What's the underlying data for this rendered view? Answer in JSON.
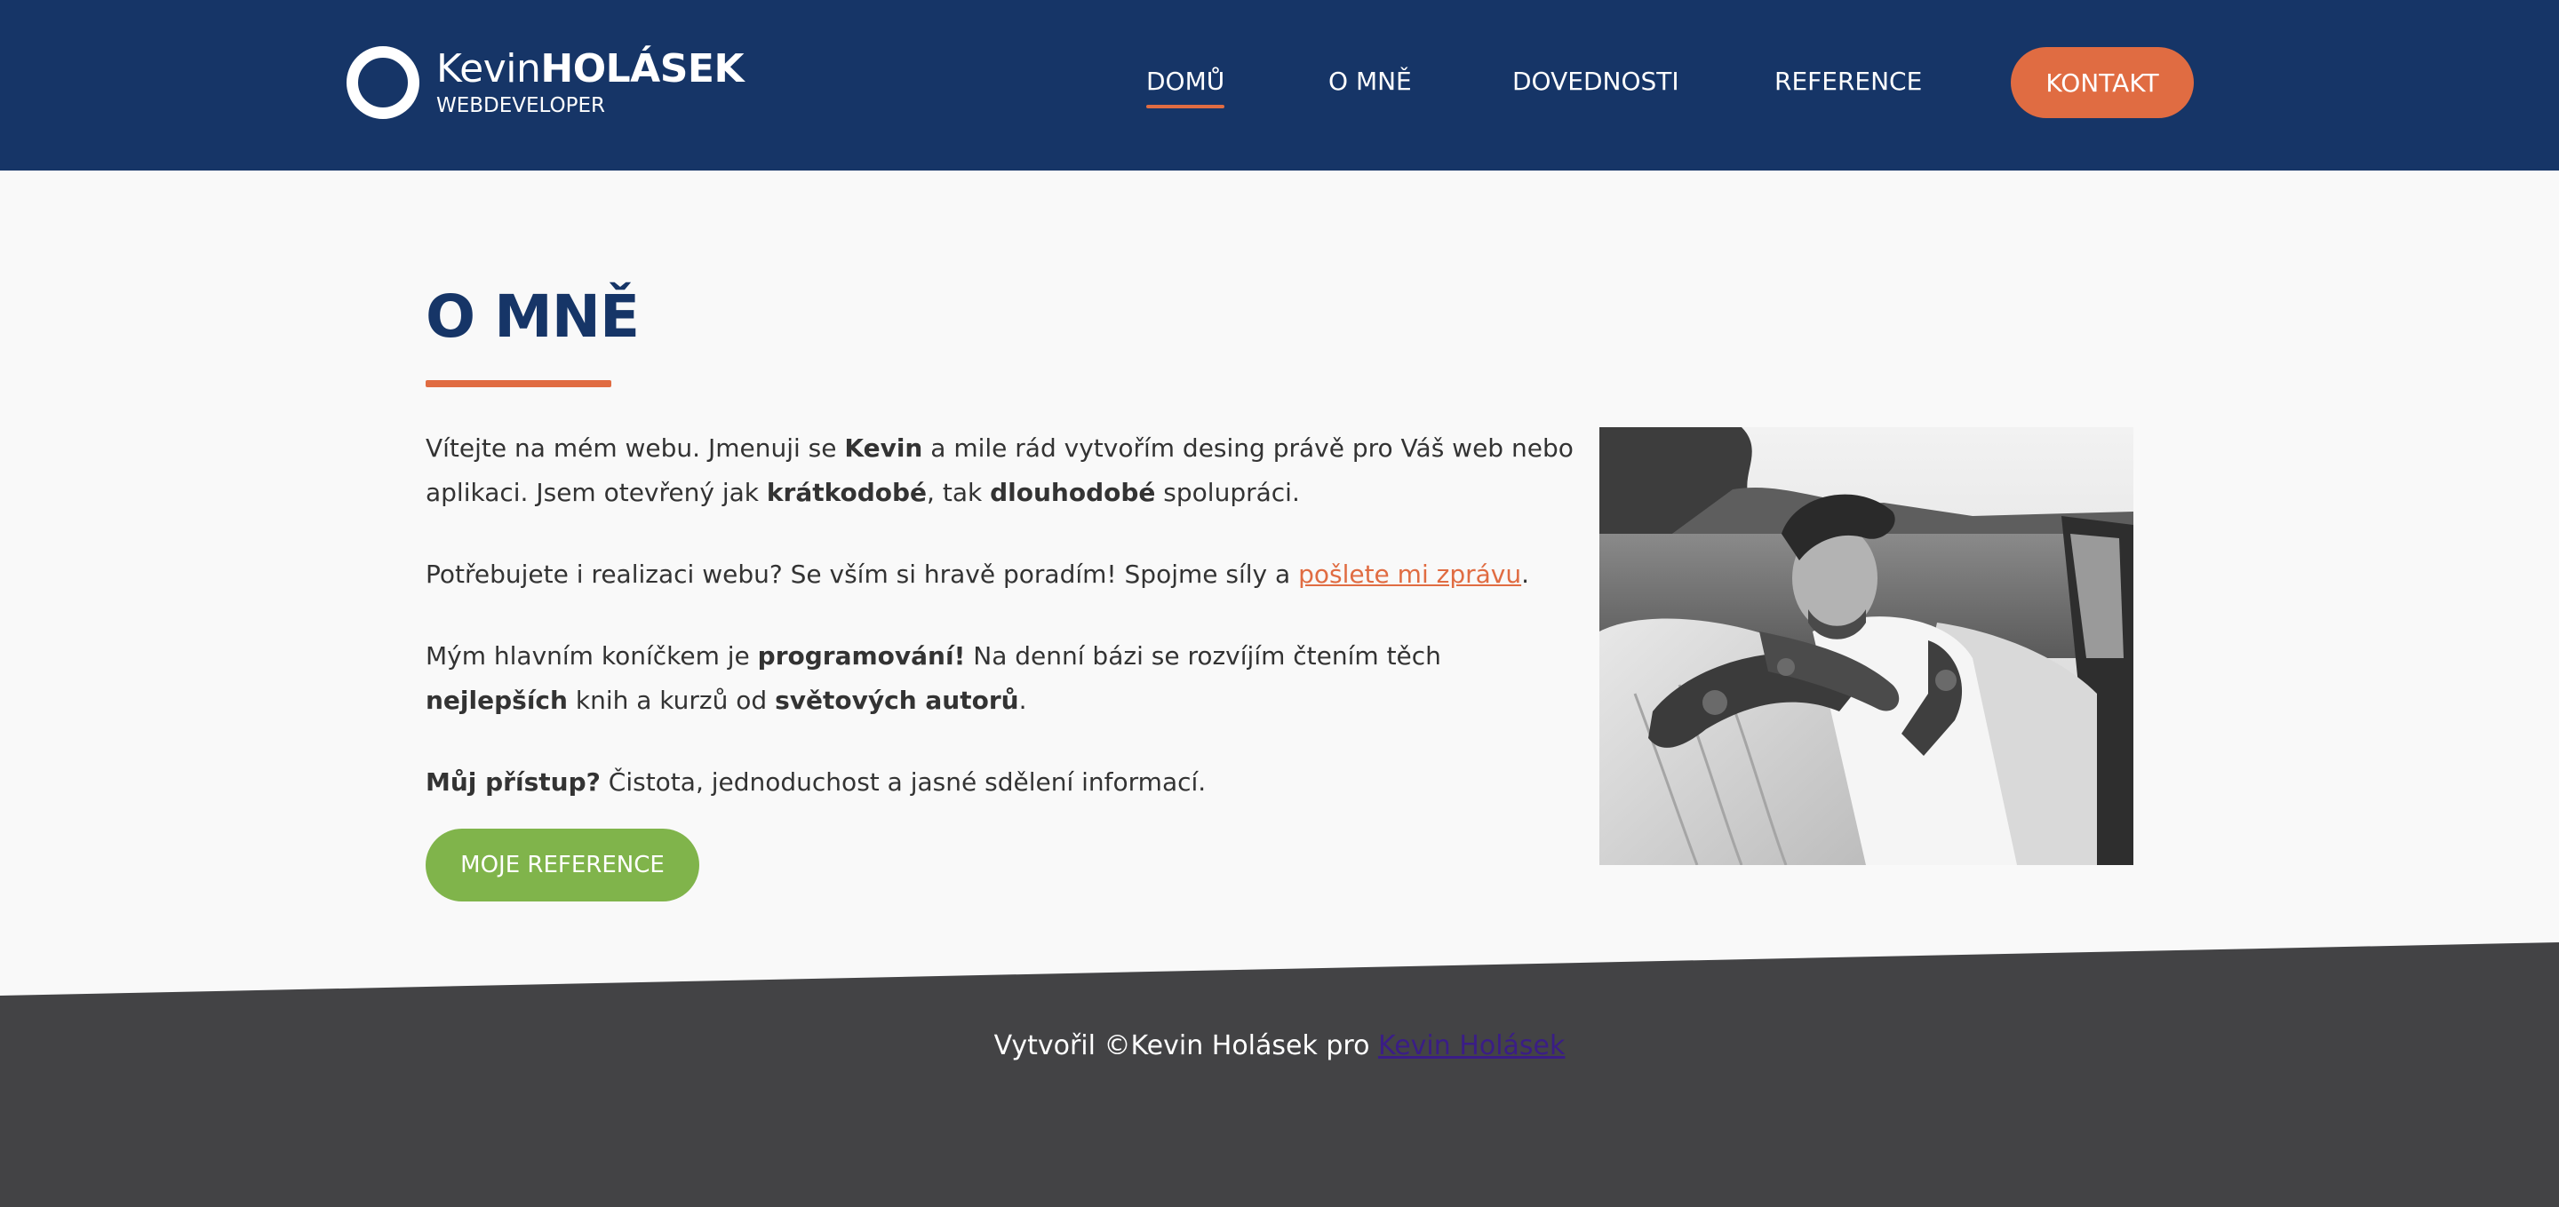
{
  "header": {
    "logo": {
      "first": "Kevin",
      "last": "HOLÁSEK",
      "subtitle": "WEBDEVELOPER"
    },
    "nav": [
      {
        "label": "DOMŮ",
        "active": true
      },
      {
        "label": "O MNĚ",
        "active": false
      },
      {
        "label": "DOVEDNOSTI",
        "active": false
      },
      {
        "label": "REFERENCE",
        "active": false
      }
    ],
    "contact_label": "KONTAKT"
  },
  "about": {
    "title": "O MNĚ",
    "p1": {
      "t1": "Vítejte na mém webu. Jmenuji se ",
      "b1": "Kevin",
      "t2": " a mile rád vytvořím desing právě pro Váš web nebo aplikaci. Jsem otevřený jak ",
      "b2": "krátkodobé",
      "t3": ", tak ",
      "b3": "dlouhodobé",
      "t4": " spolupráci."
    },
    "p2": {
      "t1": "Potřebujete i realizaci webu? Se vším si hravě poradím! Spojme síly a ",
      "link": "pošlete mi zprávu",
      "t2": "."
    },
    "p3": {
      "t1": "Mým hlavním koníčkem je ",
      "b1": "programování!",
      "t2": " Na denní bázi se rozvíjím čtením těch ",
      "b2": "nejlepších",
      "t3": " knih a kurzů od ",
      "b3": "světových autorů",
      "t4": "."
    },
    "p4": {
      "b1": "Můj přístup?",
      "t1": " Čistota, jednoduchost a jasné sdělení informací."
    },
    "button_label": "MOJE REFERENCE"
  },
  "footer": {
    "text": "Vytvořil ©Kevin Holásek pro ",
    "link": "Kevin Holásek"
  },
  "colors": {
    "navy": "#163567",
    "orange": "#e06c42",
    "green": "#80b44b",
    "footer": "#434345",
    "link_footer": "#3a1d86"
  }
}
